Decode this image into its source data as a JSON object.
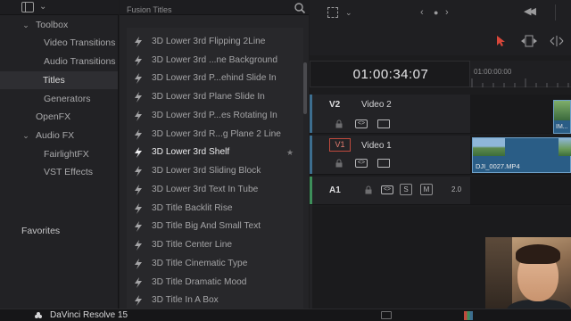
{
  "toolbox": {
    "items": [
      {
        "label": "Toolbox",
        "expandable": true,
        "expanded": true
      },
      {
        "label": "Video Transitions"
      },
      {
        "label": "Audio Transitions"
      },
      {
        "label": "Titles",
        "selected": true
      },
      {
        "label": "Generators"
      },
      {
        "label": "OpenFX"
      },
      {
        "label": "Audio FX",
        "expandable": true,
        "expanded": true
      },
      {
        "label": "FairlightFX"
      },
      {
        "label": "VST Effects"
      }
    ],
    "favorites_label": "Favorites"
  },
  "titles_list": {
    "section_title": "Fusion Titles",
    "items": [
      "3D Lower 3rd Flipping 2Line",
      "3D Lower 3rd ...ne Background",
      "3D Lower 3rd P...ehind Slide In",
      "3D Lower 3rd Plane Slide In",
      "3D Lower 3rd P...es Rotating In",
      "3D Lower 3rd R...g Plane 2 Line",
      "3D Lower 3rd Shelf",
      "3D Lower 3rd Sliding Block",
      "3D Lower 3rd Text In Tube",
      "3D Title Backlit Rise",
      "3D Title Big And Small Text",
      "3D Title Center Line",
      "3D Title Cinematic Type",
      "3D Title Dramatic Mood",
      "3D Title In A Box"
    ],
    "highlighted": "3D Lower 3rd Shelf",
    "favorite_star": "★"
  },
  "timeline": {
    "timecode": "01:00:34:07",
    "ruler_timecode": "01:00:00:00",
    "tracks": [
      {
        "id": "V2",
        "name": "Video 2",
        "clip": "IM..."
      },
      {
        "id": "V1",
        "name": "Video 1",
        "clip": "DJI_0027.MP4"
      },
      {
        "id": "A1",
        "level": "2.0"
      }
    ],
    "audio_buttons": {
      "solo": "S",
      "mute": "M"
    },
    "eye_glyph": "<>"
  },
  "status_bar": {
    "app_name": "DaVinci Resolve 15"
  },
  "icons": {
    "panel_toggle": "panel-toggle-icon",
    "search": "search-icon",
    "bolt": "lightning-bolt-icon",
    "lock": "lock-icon",
    "arrow_tool": "arrow-selection-icon",
    "trim_tool": "trim-tool-icon",
    "blade_tool": "blade-tool-icon",
    "resolve_logo": "resolve-logo-icon"
  },
  "colors": {
    "accent_red": "#c04a3d",
    "clip_blue": "#2a5d86",
    "video_track": "#3d6e8f",
    "audio_track": "#3d8f5a"
  }
}
